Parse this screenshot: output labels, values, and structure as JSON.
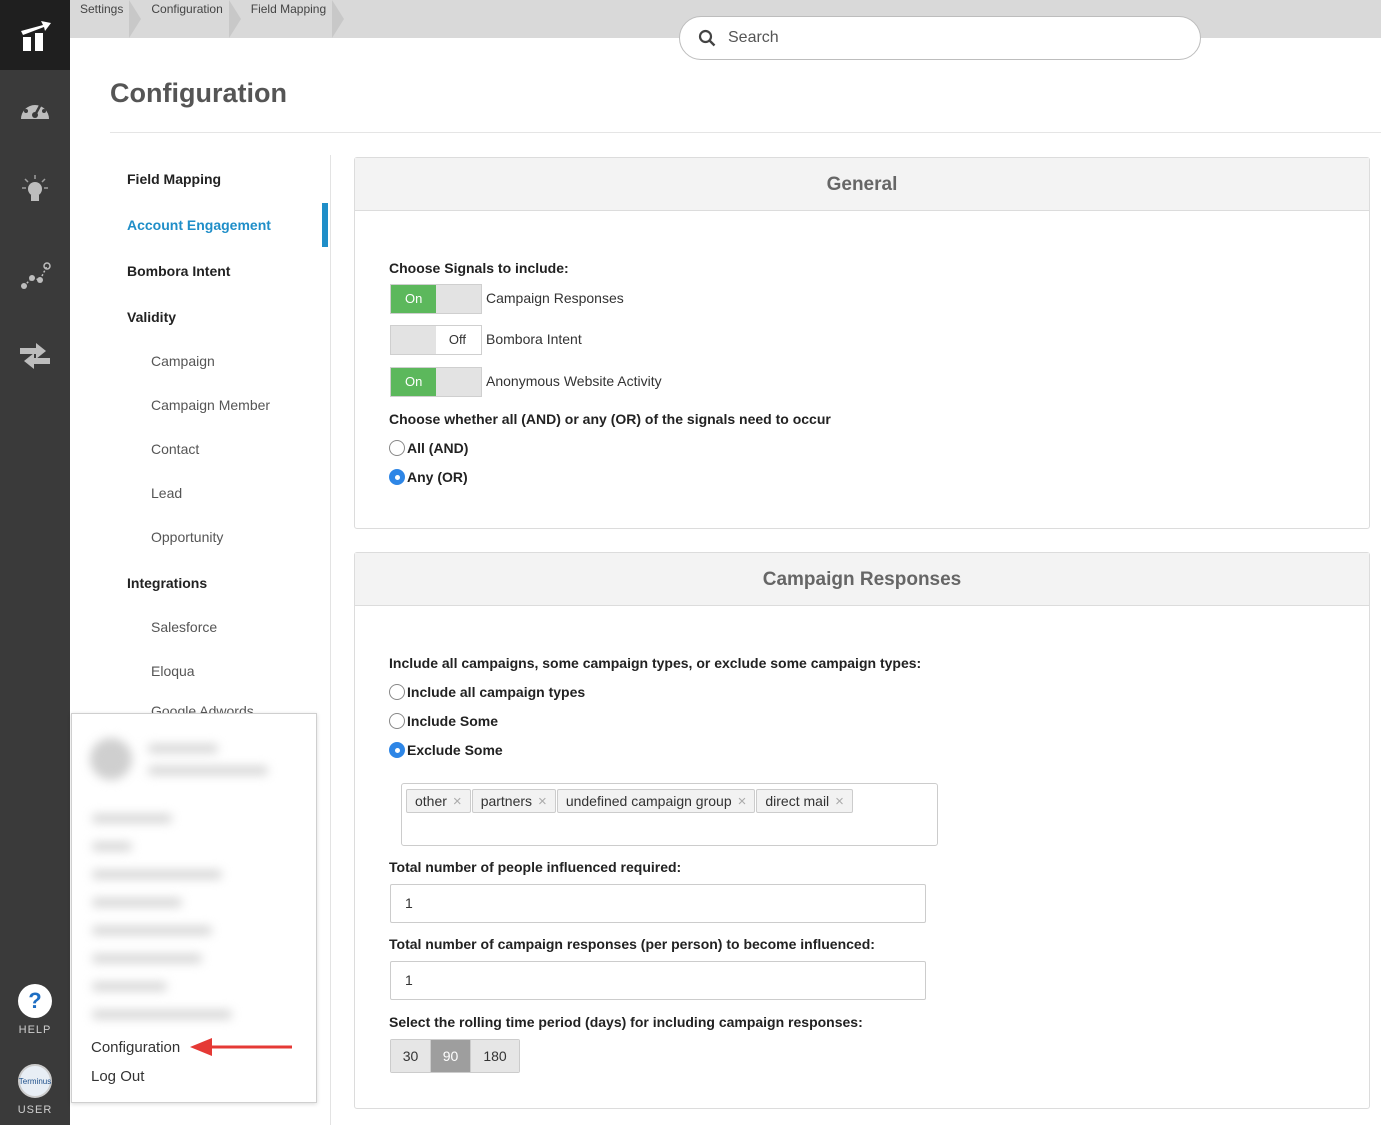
{
  "breadcrumb": [
    "Settings",
    "Configuration",
    "Field Mapping"
  ],
  "search": {
    "placeholder": "Search"
  },
  "page_title": "Configuration",
  "subnav": {
    "field_mapping": "Field Mapping",
    "account_engagement": "Account Engagement",
    "bombora_intent": "Bombora Intent",
    "validity": "Validity",
    "campaign": "Campaign",
    "campaign_member": "Campaign Member",
    "contact": "Contact",
    "lead": "Lead",
    "opportunity": "Opportunity",
    "integrations": "Integrations",
    "salesforce": "Salesforce",
    "eloqua": "Eloqua",
    "google_adwords": "Google Adwords"
  },
  "general": {
    "title": "General",
    "signals_label": "Choose Signals to include:",
    "toggles": [
      {
        "label": "Campaign Responses",
        "state": "On"
      },
      {
        "label": "Bombora Intent",
        "state": "Off"
      },
      {
        "label": "Anonymous Website Activity",
        "state": "On"
      }
    ],
    "logic_label": "Choose whether all (AND) or any (OR) of the signals need to occur",
    "logic_options": [
      "All (AND)",
      "Any (OR)"
    ],
    "logic_selected": "Any (OR)"
  },
  "campaign_responses": {
    "title": "Campaign Responses",
    "types_label": "Include all campaigns, some campaign types, or exclude some campaign types:",
    "type_options": [
      "Include all campaign types",
      "Include Some",
      "Exclude Some"
    ],
    "type_selected": "Exclude Some",
    "excluded_tags": [
      "other",
      "partners",
      "undefined campaign group",
      "direct mail"
    ],
    "people_label": "Total number of people influenced required:",
    "people_value": "1",
    "responses_label": "Total number of campaign responses (per person) to become influenced:",
    "responses_value": "1",
    "period_label": "Select the rolling time period (days) for including campaign responses:",
    "period_options": [
      "30",
      "90",
      "180"
    ],
    "period_selected": "90"
  },
  "rail": {
    "help_label": "HELP",
    "user_label": "USER",
    "avatar_text": "Terminus"
  },
  "user_menu": {
    "configuration": "Configuration",
    "logout": "Log Out"
  },
  "colors": {
    "accent": "#1f8ec8",
    "toggle_on": "#5cb85c",
    "arrow": "#e53935",
    "rail": "#3a3a3a"
  }
}
